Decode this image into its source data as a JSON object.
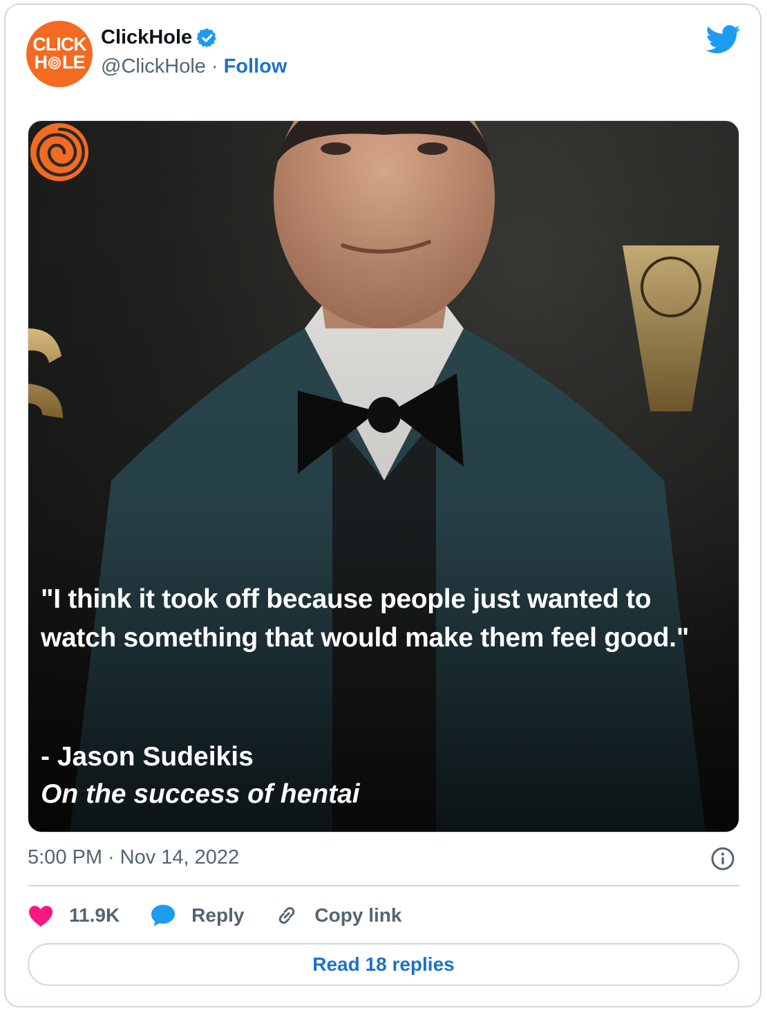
{
  "account": {
    "avatar_line1": "CLICK",
    "avatar_line2_a": "H",
    "avatar_line2_b": "LE",
    "name": "ClickHole",
    "handle": "@ClickHole",
    "separator": "·",
    "follow_label": "Follow",
    "verified_icon": "verified-badge-icon",
    "brand_color": "#f26b21"
  },
  "media": {
    "quote": "\"I think it took off because people just wanted to watch something that would make them feel good.\"",
    "attribution": "- Jason Sudeikis",
    "subtitle": "On the success of hentai"
  },
  "meta": {
    "time": "5:00 PM",
    "separator": "·",
    "date": "Nov 14, 2022"
  },
  "actions": {
    "likes": "11.9K",
    "reply_label": "Reply",
    "copy_label": "Copy link",
    "read_replies_label": "Read 18 replies"
  },
  "colors": {
    "like": "#f91880",
    "reply": "#1d9bf0",
    "link": "#1d72c7",
    "twitter": "#1d9bf0"
  }
}
